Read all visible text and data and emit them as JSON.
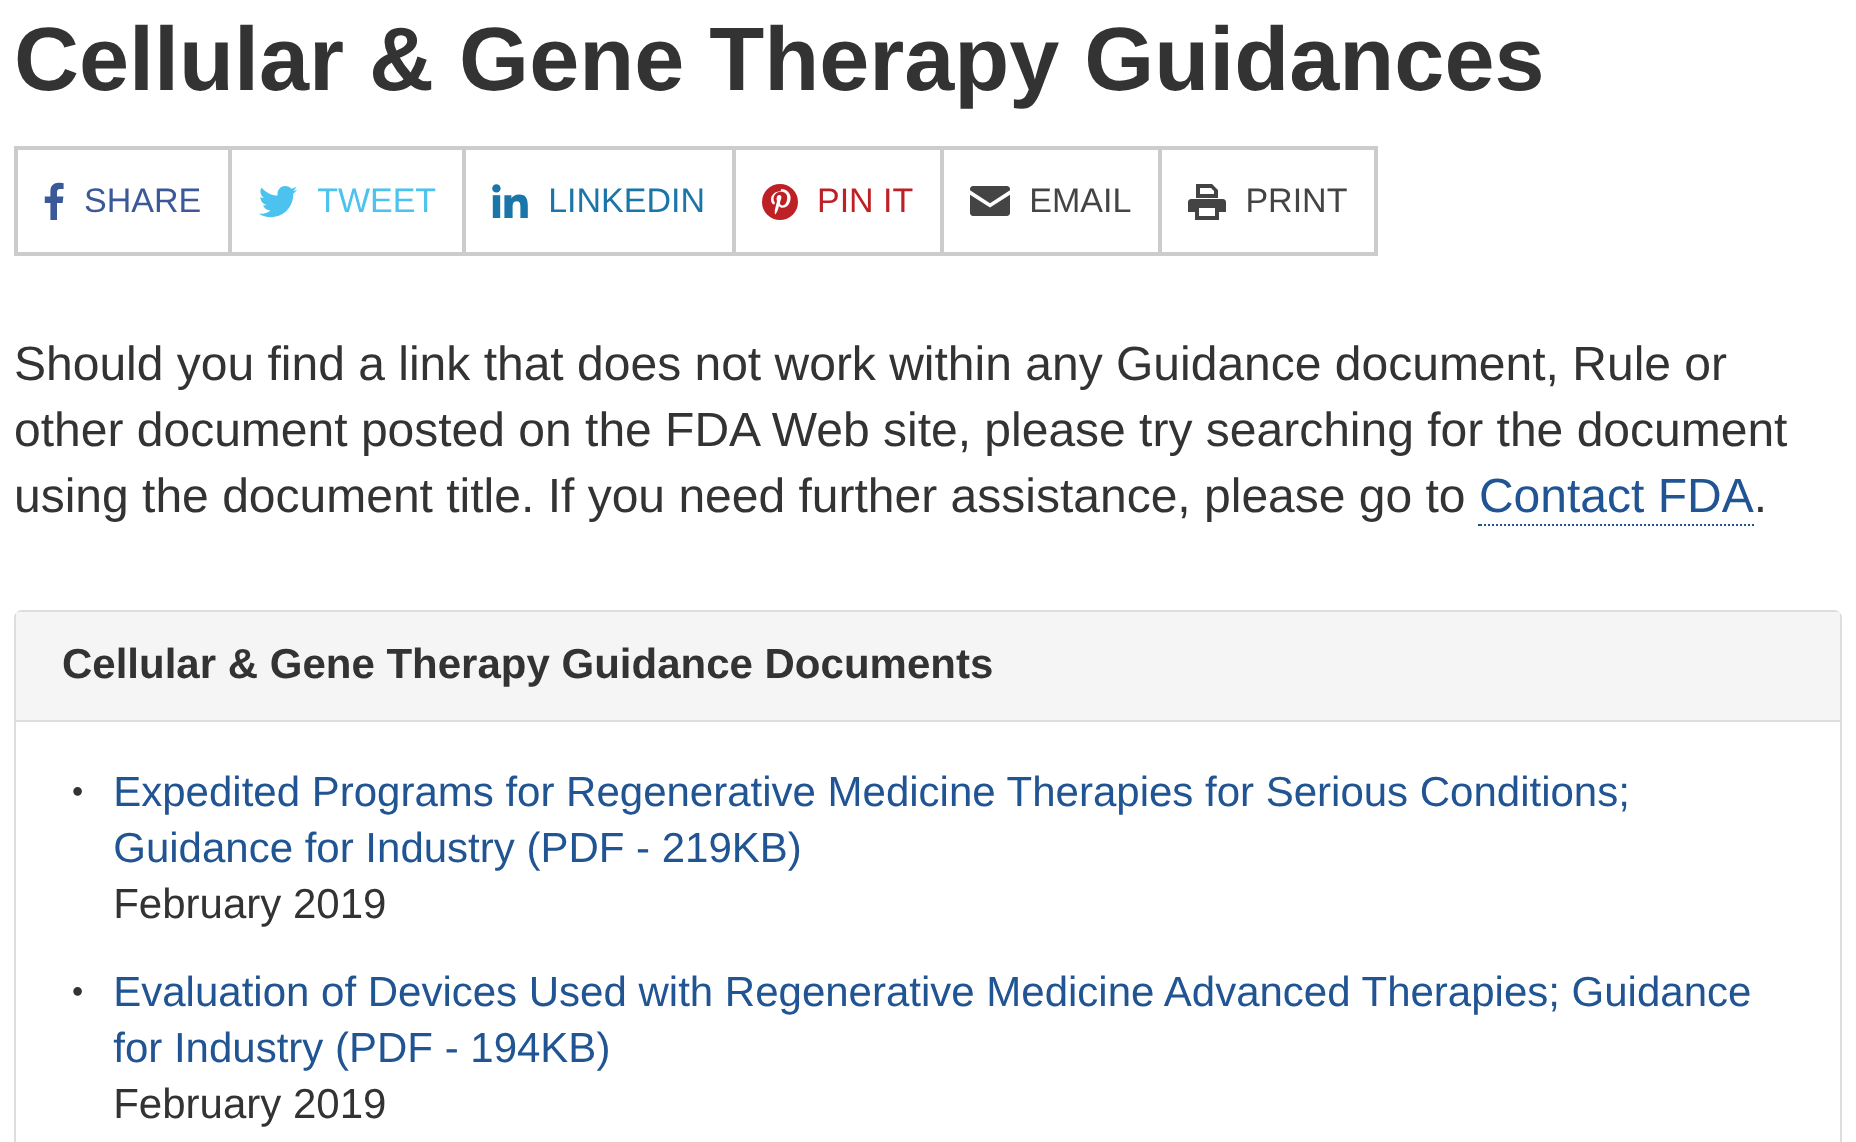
{
  "title": "Cellular & Gene Therapy Guidances",
  "share_buttons": [
    {
      "kind": "facebook",
      "label": "SHARE",
      "color": "#3b5998"
    },
    {
      "kind": "twitter",
      "label": "TWEET",
      "color": "#4cc2ee"
    },
    {
      "kind": "linkedin",
      "label": "LINKEDIN",
      "color": "#1a75a8"
    },
    {
      "kind": "pinterest",
      "label": "PIN IT",
      "color": "#bd2126"
    },
    {
      "kind": "email",
      "label": "EMAIL",
      "color": "#444444"
    },
    {
      "kind": "print",
      "label": "PRINT",
      "color": "#444444"
    }
  ],
  "intro": {
    "text": "Should you find a link that does not work within any Guidance document, Rule or other document posted on the FDA Web site, please try searching for the document using the document title. If you need further assistance, please go to ",
    "link": "Contact FDA",
    "end": "."
  },
  "panel": {
    "heading": "Cellular & Gene Therapy Guidance Documents",
    "items": [
      {
        "bullet": "•",
        "link": "Expedited Programs for Regenerative Medicine Therapies for Serious Conditions; Guidance for Industry (PDF - 219KB)",
        "date": "February 2019"
      },
      {
        "bullet": "•",
        "link": "Evaluation of Devices Used with Regenerative Medicine Advanced Therapies; Guidance for Industry (PDF - 194KB)",
        "date": "February 2019"
      }
    ]
  }
}
